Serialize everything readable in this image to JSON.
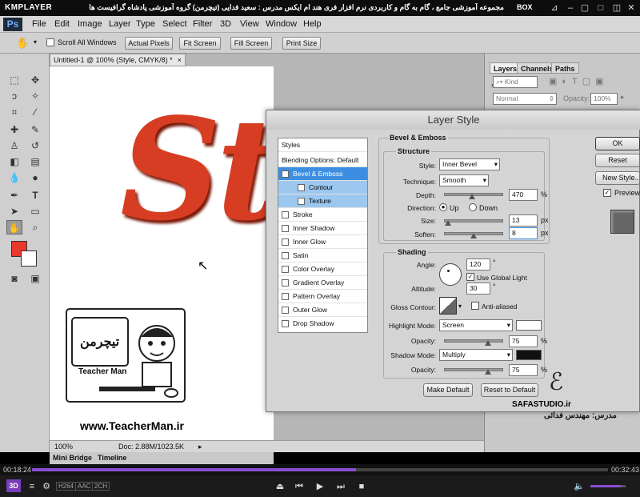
{
  "player": {
    "logo": "KMPLAYER",
    "title": "مجموعه آموزشی جامع ، گام به گام و کاربردی نرم افزار فری هند ام ایکس  مدرس : سعید فدایی (تیچرمن) گروه آموزشی پادشاه گرافیست ها",
    "box": "BOX",
    "time_current": "00:18:24",
    "time_total": "00:32:43",
    "badges": [
      "H264",
      "AAC",
      "2CH"
    ],
    "progress": 0.563
  },
  "menu": {
    "logo": "Ps",
    "items": [
      "File",
      "Edit",
      "Image",
      "Layer",
      "Type",
      "Select",
      "Filter",
      "3D",
      "View",
      "Window",
      "Help"
    ]
  },
  "options": {
    "scroll_all": "Scroll All Windows",
    "buttons": [
      "Actual Pixels",
      "Fit Screen",
      "Fill Screen",
      "Print Size"
    ]
  },
  "doc": {
    "tab": "Untitled-1 @ 100% (Style, CMYK/8) *",
    "text": "Sty",
    "zoom": "100%",
    "doc_info": "Doc: 2.88M/1023.5K",
    "bottom_tabs": [
      "Mini Bridge",
      "Timeline"
    ]
  },
  "panels": {
    "tabs": [
      "Layers",
      "Channels",
      "Paths"
    ],
    "kind": "Kind",
    "mode": "Normal",
    "opacity_label": "Opacity:",
    "opacity": "100%"
  },
  "dialog": {
    "title": "Layer Style",
    "list_header": "Styles",
    "blending": "Blending Options: Default",
    "items": [
      {
        "label": "Bevel & Emboss",
        "checked": true
      },
      {
        "label": "Contour",
        "checked": false
      },
      {
        "label": "Texture",
        "checked": false
      },
      {
        "label": "Stroke",
        "checked": false
      },
      {
        "label": "Inner Shadow",
        "checked": false
      },
      {
        "label": "Inner Glow",
        "checked": false
      },
      {
        "label": "Satin",
        "checked": false
      },
      {
        "label": "Color Overlay",
        "checked": false
      },
      {
        "label": "Gradient Overlay",
        "checked": false
      },
      {
        "label": "Pattern Overlay",
        "checked": false
      },
      {
        "label": "Outer Glow",
        "checked": false
      },
      {
        "label": "Drop Shadow",
        "checked": false
      }
    ],
    "section": "Bevel & Emboss",
    "structure": "Structure",
    "style_label": "Style:",
    "style_value": "Inner Bevel",
    "technique_label": "Technique:",
    "technique_value": "Smooth",
    "depth_label": "Depth:",
    "depth": "470",
    "depth_level": 0.47,
    "direction_label": "Direction:",
    "up": "Up",
    "down": "Down",
    "size_label": "Size:",
    "size": "13",
    "size_level": 0.05,
    "soften_label": "Soften:",
    "soften": "8",
    "soften_level": 0.5,
    "px": "px",
    "pct": "%",
    "shading": "Shading",
    "angle_label": "Angle:",
    "angle": "120",
    "deg": "°",
    "global_light": "Use Global Light",
    "altitude_label": "Altitude:",
    "altitude": "30",
    "gloss_label": "Gloss Contour:",
    "anti_aliased": "Anti-aliased",
    "highlight_label": "Highlight Mode:",
    "highlight_mode": "Screen",
    "opacity_label": "Opacity:",
    "highlight_opacity": "75",
    "highlight_opacity_level": 0.75,
    "shadow_label": "Shadow Mode:",
    "shadow_mode": "Multiply",
    "shadow_opacity": "75",
    "shadow_opacity_level": 0.75,
    "make_default": "Make Default",
    "reset_default": "Reset to Default",
    "ok": "OK",
    "reset": "Reset",
    "new_style": "New Style...",
    "preview": "Preview"
  },
  "overlay": {
    "brand_fa": "تیچرمن",
    "brand_en": "Teacher Man",
    "url": "www.TeacherMan.ir",
    "site": "SAFASTUDIO.ir",
    "teacher": "مدرس: مهندس فدائی"
  },
  "colors": {
    "text_red": "#d63d22",
    "select_blue": "#3d8ee0",
    "fg": "#e8382c",
    "progress": "#8a4fd1"
  }
}
